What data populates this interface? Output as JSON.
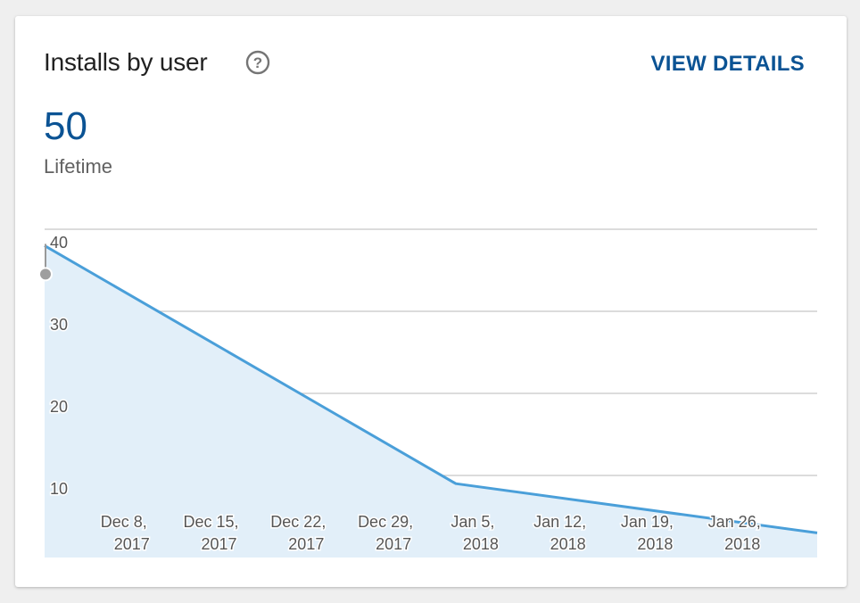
{
  "card": {
    "title": "Installs by user",
    "help_icon": "help-circle-icon",
    "view_details_label": "VIEW DETAILS",
    "metric_value": "50",
    "metric_label": "Lifetime"
  },
  "colors": {
    "accent": "#0b5394",
    "series_line": "#4a9fd9",
    "series_fill": "#e2eff9",
    "grid": "#c8c8c8"
  },
  "chart_data": {
    "type": "area",
    "title": "",
    "xlabel": "",
    "ylabel": "",
    "x": [
      "2017-12-01",
      "2018-01-03",
      "2018-02-01"
    ],
    "series": [
      {
        "values": [
          38,
          9,
          3
        ]
      }
    ],
    "ylim": [
      0,
      40
    ],
    "yticks": [
      10,
      20,
      30,
      40
    ],
    "xticks": [
      {
        "date": "2017-12-08",
        "line1": "Dec 8,",
        "line2": "2017"
      },
      {
        "date": "2017-12-15",
        "line1": "Dec 15,",
        "line2": "2017"
      },
      {
        "date": "2017-12-22",
        "line1": "Dec 22,",
        "line2": "2017"
      },
      {
        "date": "2017-12-29",
        "line1": "Dec 29,",
        "line2": "2017"
      },
      {
        "date": "2018-01-05",
        "line1": "Jan 5,",
        "line2": "2018"
      },
      {
        "date": "2018-01-12",
        "line1": "Jan 12,",
        "line2": "2018"
      },
      {
        "date": "2018-01-19",
        "line1": "Jan 19,",
        "line2": "2018"
      },
      {
        "date": "2018-01-26",
        "line1": "Jan 26,",
        "line2": "2018"
      }
    ],
    "grid": true,
    "legend": "none"
  }
}
